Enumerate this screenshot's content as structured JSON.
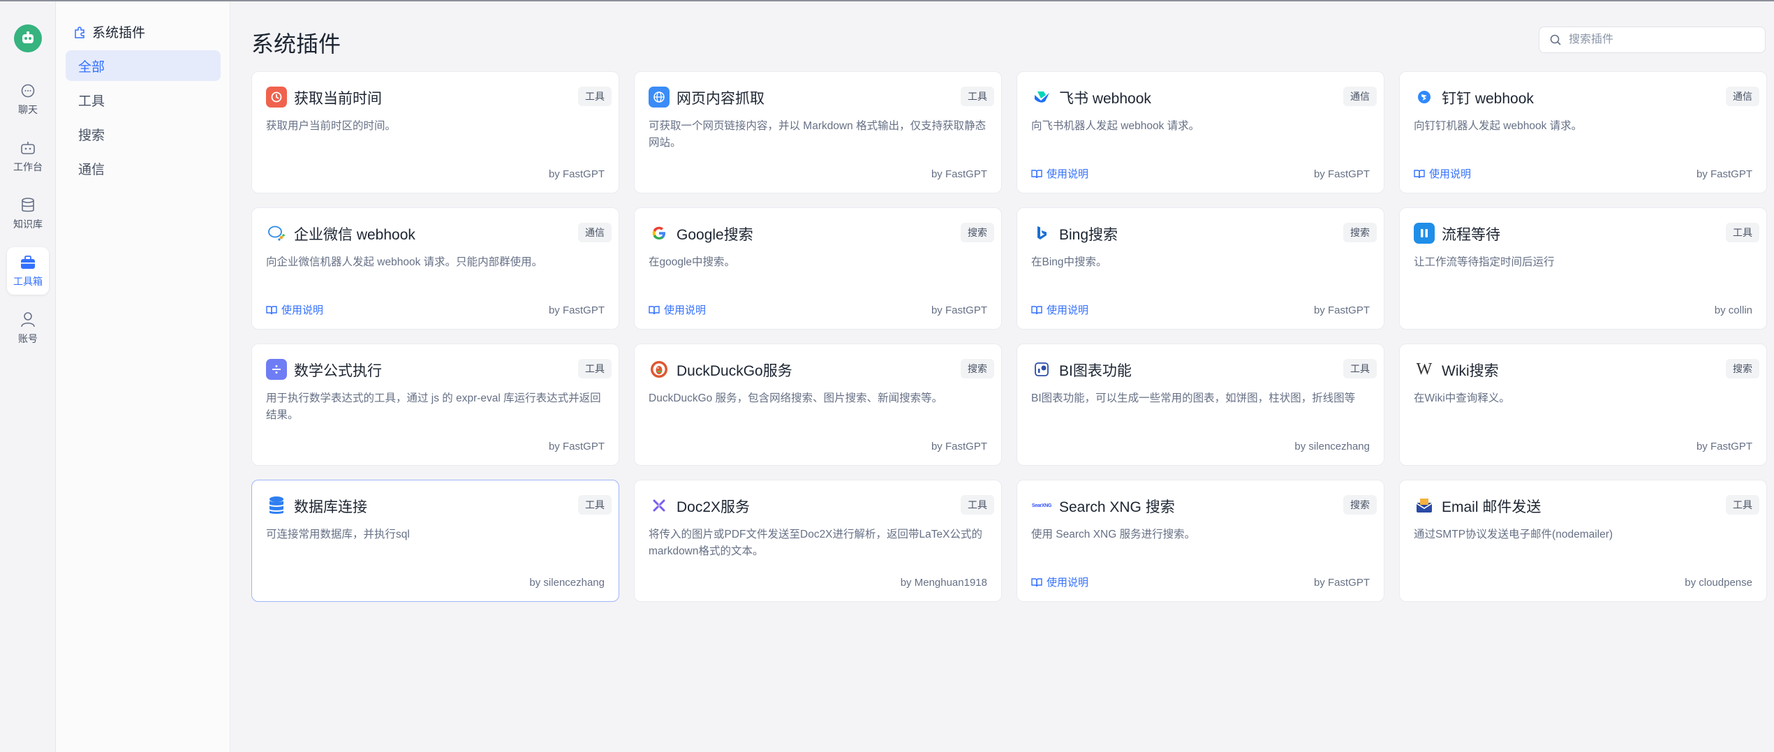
{
  "rail": {
    "items": [
      {
        "label": "聊天",
        "icon": "chat-icon"
      },
      {
        "label": "工作台",
        "icon": "robot-icon"
      },
      {
        "label": "知识库",
        "icon": "database-icon"
      },
      {
        "label": "工具箱",
        "icon": "toolbox-icon",
        "active": true
      },
      {
        "label": "账号",
        "icon": "user-icon"
      }
    ]
  },
  "sidebar": {
    "title": "系统插件",
    "items": [
      {
        "label": "全部",
        "active": true
      },
      {
        "label": "工具"
      },
      {
        "label": "搜索"
      },
      {
        "label": "通信"
      }
    ]
  },
  "main": {
    "title": "系统插件",
    "search_placeholder": "搜索插件"
  },
  "doc_link_label": "使用说明",
  "plugins": [
    {
      "title": "获取当前时间",
      "tag": "工具",
      "desc": "获取用户当前时区的时间。",
      "author": "by FastGPT",
      "doc": false,
      "icon": "clock-icon",
      "icon_color": "#f0624d"
    },
    {
      "title": "网页内容抓取",
      "tag": "工具",
      "desc": "可获取一个网页链接内容，并以 Markdown 格式输出，仅支持获取静态网站。",
      "author": "by FastGPT",
      "doc": false,
      "icon": "globe-icon",
      "icon_color": "#3b8cf7"
    },
    {
      "title": "飞书 webhook",
      "tag": "通信",
      "desc": "向飞书机器人发起 webhook 请求。",
      "author": "by FastGPT",
      "doc": true,
      "icon": "feishu-icon",
      "icon_color": "#1f6ff5"
    },
    {
      "title": "钉钉 webhook",
      "tag": "通信",
      "desc": "向钉钉机器人发起 webhook 请求。",
      "author": "by FastGPT",
      "doc": true,
      "icon": "dingtalk-icon",
      "icon_color": "#2f89fc"
    },
    {
      "title": "企业微信 webhook",
      "tag": "通信",
      "desc": "向企业微信机器人发起 webhook 请求。只能内部群使用。",
      "author": "by FastGPT",
      "doc": true,
      "icon": "wecom-icon",
      "icon_color": "#2c8ae8"
    },
    {
      "title": "Google搜索",
      "tag": "搜索",
      "desc": "在google中搜索。",
      "author": "by FastGPT",
      "doc": true,
      "icon": "google-icon",
      "icon_color": "#4285f4"
    },
    {
      "title": "Bing搜索",
      "tag": "搜索",
      "desc": "在Bing中搜索。",
      "author": "by FastGPT",
      "doc": true,
      "icon": "bing-icon",
      "icon_color": "#1b6fd4"
    },
    {
      "title": "流程等待",
      "tag": "工具",
      "desc": "让工作流等待指定时间后运行",
      "author": "by collin",
      "doc": false,
      "icon": "pause-icon",
      "icon_color": "#1f8ee8"
    },
    {
      "title": "数学公式执行",
      "tag": "工具",
      "desc": "用于执行数学表达式的工具，通过 js 的 expr-eval 库运行表达式并返回结果。",
      "author": "by FastGPT",
      "doc": false,
      "icon": "calculator-icon",
      "icon_color": "#6f7df4"
    },
    {
      "title": "DuckDuckGo服务",
      "tag": "搜索",
      "desc": "DuckDuckGo 服务，包含网络搜索、图片搜索、新闻搜索等。",
      "author": "by FastGPT",
      "doc": false,
      "icon": "duckduckgo-icon",
      "icon_color": "#de5833"
    },
    {
      "title": "BI图表功能",
      "tag": "工具",
      "desc": "BI图表功能，可以生成一些常用的图表，如饼图，柱状图，折线图等",
      "author": "by silencezhang",
      "doc": false,
      "icon": "chart-icon",
      "icon_color": "#2e4fa8"
    },
    {
      "title": "Wiki搜索",
      "tag": "搜索",
      "desc": "在Wiki中查询释义。",
      "author": "by FastGPT",
      "doc": false,
      "icon": "wikipedia-icon",
      "icon_color": "#333333"
    },
    {
      "title": "数据库连接",
      "tag": "工具",
      "desc": "可连接常用数据库，并执行sql",
      "author": "by silencezhang",
      "doc": false,
      "icon": "database-stack-icon",
      "icon_color": "#2e7ef0",
      "highlight": true
    },
    {
      "title": "Doc2X服务",
      "tag": "工具",
      "desc": "将传入的图片或PDF文件发送至Doc2X进行解析，返回带LaTeX公式的markdown格式的文本。",
      "author": "by Menghuan1918",
      "doc": false,
      "icon": "doc2x-icon",
      "icon_color": "#7b5cf0"
    },
    {
      "title": "Search XNG 搜索",
      "tag": "搜索",
      "desc": "使用 Search XNG 服务进行搜索。",
      "author": "by FastGPT",
      "doc": true,
      "icon": "searxng-icon",
      "icon_color": "#3050ff",
      "icon_text": "SearXNG"
    },
    {
      "title": "Email 邮件发送",
      "tag": "工具",
      "desc": "通过SMTP协议发送电子邮件(nodemailer)",
      "author": "by cloudpense",
      "doc": false,
      "icon": "mail-icon",
      "icon_color": "#2a4aa5"
    }
  ]
}
